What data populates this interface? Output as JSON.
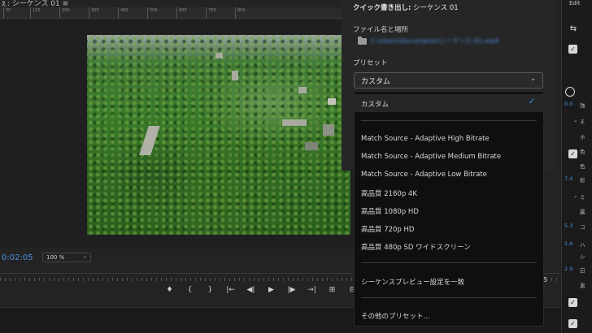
{
  "sequence_tab": {
    "title": "ぇ: シーケンス 01  ≡"
  },
  "ruler_ticks": [
    "00",
    "100",
    "200",
    "300",
    "400",
    "500",
    "600",
    "700",
    "800"
  ],
  "monitor": {
    "timecode": "0:02:05",
    "zoom": "100 %",
    "right_indicator": "5"
  },
  "transport": {
    "buttons": [
      "♦",
      "{",
      "}",
      "|←",
      "◀|",
      "▶",
      "|▶",
      "→|",
      "⊞",
      "⊟"
    ]
  },
  "export": {
    "title_bold": "クイック書き出し:",
    "title_rest": " シーケンス 01",
    "filename_label": "ファイル名と場所",
    "filename": "C:\\Users\\Documents\\シーケンス 01.mp4",
    "preset_label": "プリセット",
    "preset_value": "カスタム",
    "presets": {
      "selected": "カスタム",
      "adaptive_high": "Match Source - Adaptive High Bitrate",
      "adaptive_medium": "Match Source - Adaptive Medium Bitrate",
      "adaptive_low": "Match Source - Adaptive Low Bitrate",
      "hq_2160": "高品質 2160p 4K",
      "hq_1080": "高品質 1080p HD",
      "hq_720": "高品質 720p HD",
      "hq_480": "高品質 480p SD ワイドスクリーン",
      "match_preview": "シーケンスプレビュー設定を一致",
      "more": "その他のプリセット…"
    }
  },
  "right_panel": {
    "tab": "Edit",
    "blue_values": [
      "0.0",
      "7.4",
      "5.3",
      "5.6",
      "2.9"
    ],
    "chars": [
      "強",
      "え",
      "ホ",
      "色",
      "色",
      "彩",
      "ミ",
      "露",
      "コ",
      "ハ",
      "シ",
      "白",
      "黒"
    ]
  },
  "colors": {
    "accent": "#4a90e2",
    "panel": "#262626",
    "dropdown": "#0f0f0f"
  }
}
